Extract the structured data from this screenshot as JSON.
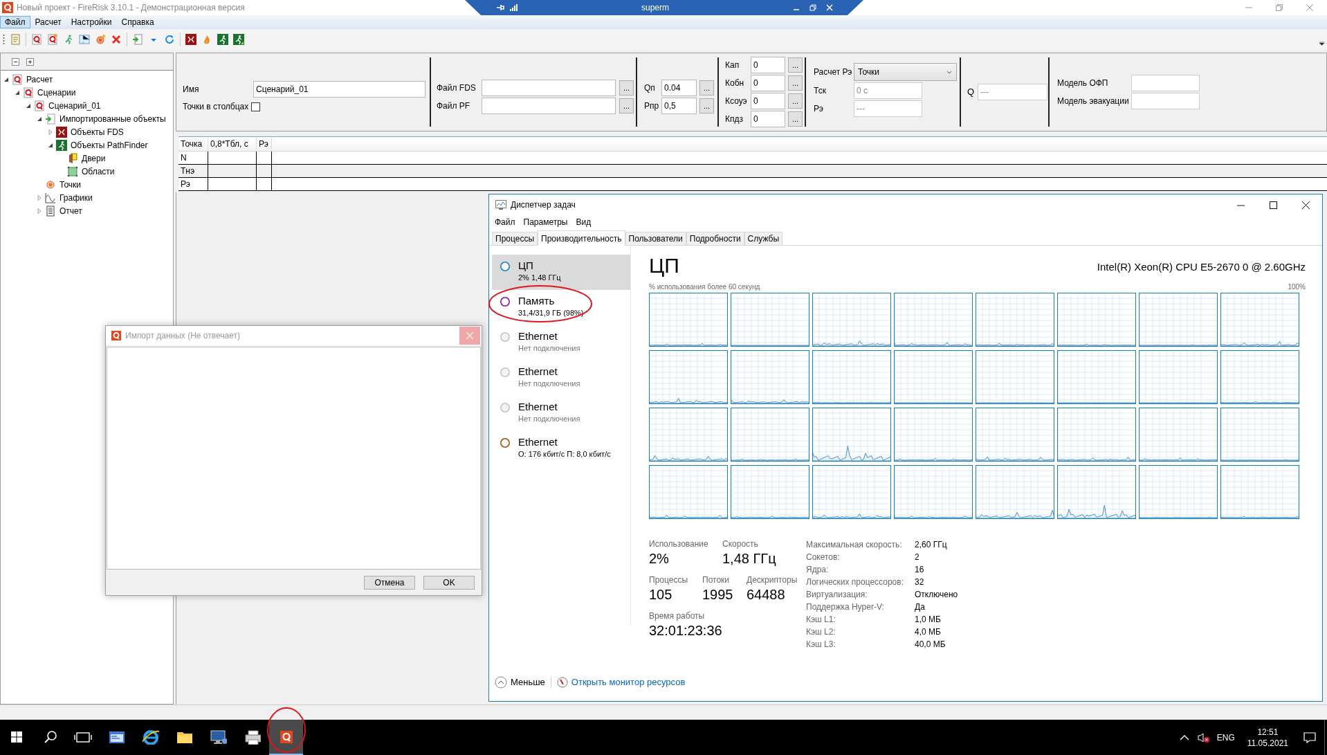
{
  "window": {
    "title": "Новый проект - FireRisk 3.10.1 - Демонстрационная версия"
  },
  "remote_bar": {
    "title": "superm"
  },
  "menu": [
    {
      "label": "Файл",
      "selected": true
    },
    {
      "label": "Расчет",
      "selected": false
    },
    {
      "label": "Настройки",
      "selected": false
    },
    {
      "label": "Справка",
      "selected": false
    }
  ],
  "tree": [
    {
      "label": "Расчет",
      "kind": "q",
      "expanded": true,
      "children": [
        {
          "label": "Сценарии",
          "kind": "q",
          "expanded": true,
          "children": [
            {
              "label": "Сценарий_01",
              "kind": "q",
              "expanded": true,
              "children": [
                {
                  "label": "Импортированные объекты",
                  "kind": "import",
                  "expanded": true,
                  "children": [
                    {
                      "label": "Объекты FDS",
                      "kind": "fds",
                      "expanded": false
                    },
                    {
                      "label": "Объекты PathFinder",
                      "kind": "pathfinder",
                      "expanded": true,
                      "children": [
                        {
                          "label": "Двери",
                          "kind": "door"
                        },
                        {
                          "label": "Области",
                          "kind": "area"
                        }
                      ]
                    }
                  ]
                },
                {
                  "label": "Точки",
                  "kind": "point"
                },
                {
                  "label": "Графики",
                  "kind": "chart",
                  "expanded": false
                },
                {
                  "label": "Отчет",
                  "kind": "report",
                  "expanded": false
                }
              ]
            }
          ]
        }
      ]
    }
  ],
  "form": {
    "name": {
      "label": "Имя",
      "value": "Сценарий_01"
    },
    "points_in_columns": {
      "label": "Точки в столбцах",
      "checked": false
    },
    "files": [
      {
        "label": "Файл FDS",
        "button": "..."
      },
      {
        "label": "Файл PF",
        "button": "..."
      }
    ],
    "q_params": [
      {
        "label": "Qп",
        "value": "0.04",
        "button": "..."
      },
      {
        "label": "Рпр",
        "value": "0,5",
        "button": "..."
      }
    ],
    "k_params": [
      {
        "label": "Кап",
        "value": "0",
        "button": "..."
      },
      {
        "label": "Кобн",
        "value": "0",
        "button": "..."
      },
      {
        "label": "Ксоуэ",
        "value": "0",
        "button": "..."
      },
      {
        "label": "Кпдз",
        "value": "0",
        "button": "..."
      }
    ],
    "calc_mode": {
      "label": "Расчет Рэ",
      "value": "Точки"
    },
    "results": [
      {
        "label": "Тск",
        "value": "0 с"
      },
      {
        "label": "Рэ",
        "value": "---"
      }
    ],
    "q": {
      "label": "Q",
      "value": "---"
    },
    "models": [
      {
        "label": "Модель ОФП"
      },
      {
        "label": "Модель эвакуации"
      }
    ]
  },
  "grid": {
    "columns": [
      "Точка",
      "0,8*Тбл, с",
      "Рэ"
    ],
    "rows": [
      "N",
      "Тнэ",
      "Рэ"
    ]
  },
  "import_dialog": {
    "title": "Импорт данных (Не отвечает)",
    "buttons": [
      "Отмена",
      "OK"
    ]
  },
  "task_manager": {
    "title": "Диспетчер задач",
    "menu": [
      "Файл",
      "Параметры",
      "Вид"
    ],
    "tabs": [
      {
        "label": "Процессы",
        "selected": false
      },
      {
        "label": "Производительность",
        "selected": true
      },
      {
        "label": "Пользователи",
        "selected": false
      },
      {
        "label": "Подробности",
        "selected": false
      },
      {
        "label": "Службы",
        "selected": false
      }
    ],
    "resources": [
      {
        "name": "ЦП",
        "detail": "2% 1,48 ГГц",
        "color": "#1a7dc0",
        "selected": true,
        "connected": true
      },
      {
        "name": "Память",
        "detail": "31,4/31,9 ГБ (98%)",
        "color": "#8b12ae",
        "selected": false,
        "connected": true
      },
      {
        "name": "Ethernet",
        "detail": "Нет подключения",
        "color": "#c4c4c4",
        "selected": false,
        "connected": false
      },
      {
        "name": "Ethernet",
        "detail": "Нет подключения",
        "color": "#c4c4c4",
        "selected": false,
        "connected": false
      },
      {
        "name": "Ethernet",
        "detail": "Нет подключения",
        "color": "#c4c4c4",
        "selected": false,
        "connected": false
      },
      {
        "name": "Ethernet",
        "detail": "О: 176 кбит/с П: 8,0 кбит/с",
        "color": "#a74f01",
        "selected": false,
        "connected": true
      }
    ],
    "heading": "ЦП",
    "cpu_name": "Intel(R) Xeon(R) CPU E5-2670 0 @ 2.60GHz",
    "graph_caption": "% использования более 60 секунд",
    "graph_max": "100%",
    "stats": [
      {
        "label": "Использование",
        "value": "2%"
      },
      {
        "label": "Скорость",
        "value": "1,48 ГГц"
      },
      {
        "label": "Процессы",
        "value": "105"
      },
      {
        "label": "Потоки",
        "value": "1995"
      },
      {
        "label": "Дескрипторы",
        "value": "64488"
      },
      {
        "label": "Время работы",
        "value": "32:01:23:36"
      }
    ],
    "specs": [
      {
        "label": "Максимальная скорость:",
        "value": "2,60 ГГц"
      },
      {
        "label": "Сокетов:",
        "value": "2"
      },
      {
        "label": "Ядра:",
        "value": "16"
      },
      {
        "label": "Логических процессоров:",
        "value": "32"
      },
      {
        "label": "Виртуализация:",
        "value": "Отключено"
      },
      {
        "label": "Поддержка Hyper-V:",
        "value": "Да"
      },
      {
        "label": "Кэш L1:",
        "value": "1,0 МБ"
      },
      {
        "label": "Кэш L2:",
        "value": "4,0 МБ"
      },
      {
        "label": "Кэш L3:",
        "value": "40,0 МБ"
      }
    ],
    "less": "Меньше",
    "monitor_link": "Открыть монитор ресурсов"
  },
  "taskbar": {
    "apps": [
      {
        "kind": "store",
        "active": false
      },
      {
        "kind": "ie",
        "active": false
      },
      {
        "kind": "explorer",
        "active": false
      },
      {
        "kind": "remote",
        "active": false
      },
      {
        "kind": "printer",
        "active": false
      },
      {
        "kind": "firerisk",
        "active": true
      }
    ],
    "language": "ENG",
    "time": "12:51",
    "date": "11.05.2021"
  }
}
